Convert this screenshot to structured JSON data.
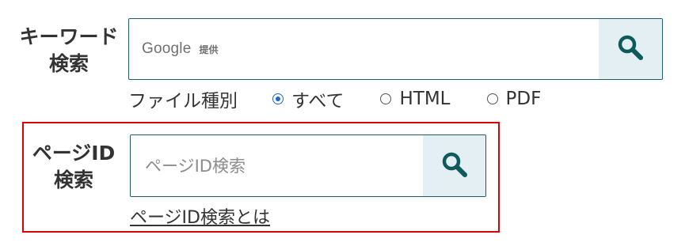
{
  "keyword_search": {
    "label_line1": "キーワード",
    "label_line2": "検索",
    "google_word": "Google",
    "google_suffix": "提供",
    "search_button_icon": "search-icon"
  },
  "file_type": {
    "label": "ファイル種別",
    "options": [
      {
        "label": "すべて",
        "checked": true
      },
      {
        "label": "HTML",
        "checked": false
      },
      {
        "label": "PDF",
        "checked": false
      }
    ]
  },
  "page_id_search": {
    "label_line1": "ページID",
    "label_line2": "検索",
    "placeholder": "ページID検索",
    "value": "",
    "help_link": "ページID検索とは",
    "search_button_icon": "search-icon"
  },
  "colors": {
    "border": "#1f5c66",
    "button_bg": "#e3eff3",
    "icon": "#0f5a5a",
    "highlight_frame": "#d9000d",
    "radio_checked": "#1a66d2"
  }
}
